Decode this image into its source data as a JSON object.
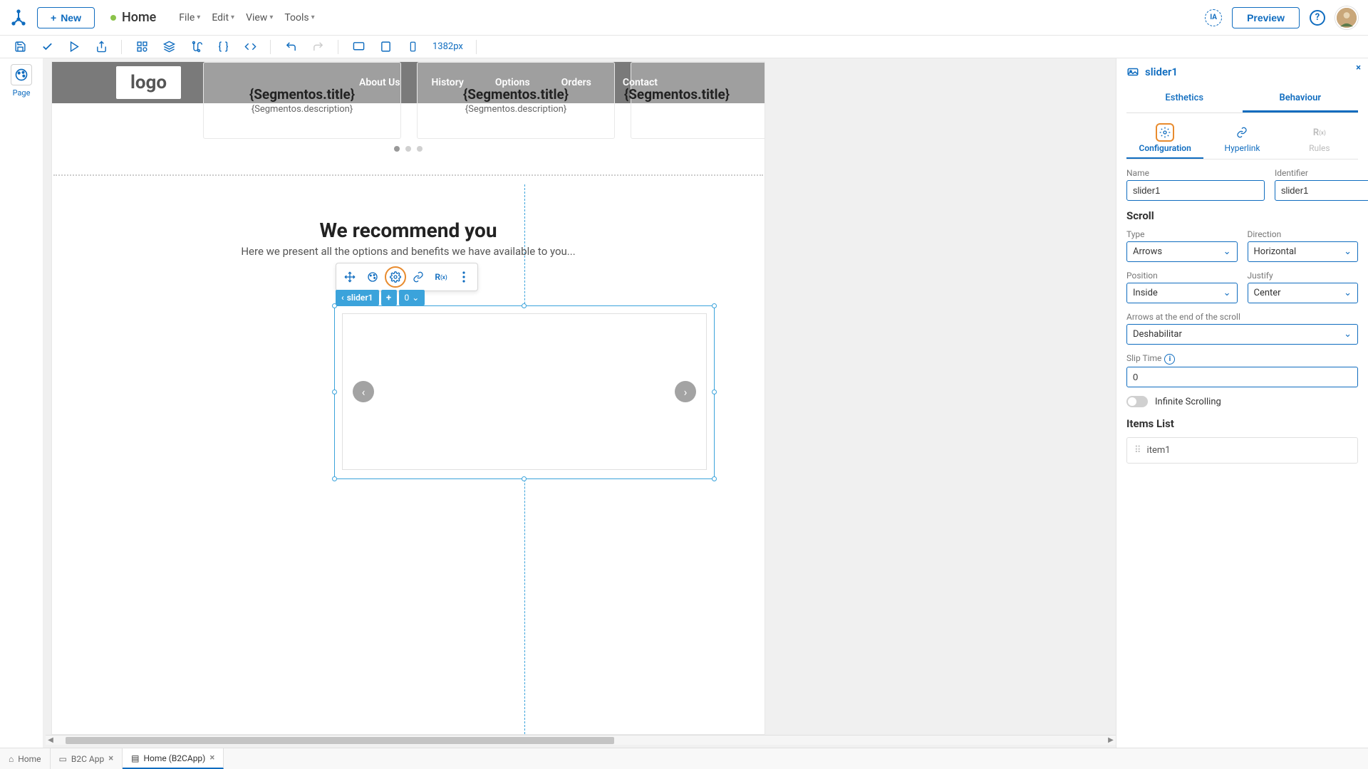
{
  "header": {
    "new_label": "New",
    "page_title": "Home",
    "menus": [
      "File",
      "Edit",
      "View",
      "Tools"
    ],
    "preview_label": "Preview",
    "ia_label": "IA"
  },
  "toolbar": {
    "viewport_size": "1382px"
  },
  "left_rail": {
    "page_label": "Page"
  },
  "canvas": {
    "site_logo": "logo",
    "site_nav": [
      "About Us",
      "History",
      "Options",
      "Orders",
      "Contact"
    ],
    "card_title": "{Segmentos.title}",
    "card_desc": "{Segmentos.description}",
    "recommend_title": "We recommend you",
    "recommend_sub": "Here we present all the options and benefits we have available to you...",
    "selected_component": "slider1",
    "count_label": "0"
  },
  "props": {
    "title": "slider1",
    "tabs": {
      "esthetics": "Esthetics",
      "behaviour": "Behaviour"
    },
    "subtabs": {
      "configuration": "Configuration",
      "hyperlink": "Hyperlink",
      "rules": "Rules"
    },
    "fields": {
      "name_label": "Name",
      "name_value": "slider1",
      "identifier_label": "Identifier",
      "identifier_value": "slider1",
      "scroll_heading": "Scroll",
      "type_label": "Type",
      "type_value": "Arrows",
      "direction_label": "Direction",
      "direction_value": "Horizontal",
      "position_label": "Position",
      "position_value": "Inside",
      "justify_label": "Justify",
      "justify_value": "Center",
      "arrows_end_label": "Arrows at the end of the scroll",
      "arrows_end_value": "Deshabilitar",
      "slip_time_label": "Slip Time",
      "slip_time_value": "0",
      "infinite_label": "Infinite Scrolling",
      "items_list_heading": "Items List",
      "item1": "item1"
    }
  },
  "bottom_tabs": {
    "t1": "Home",
    "t2": "B2C App",
    "t3": "Home (B2CApp)"
  }
}
